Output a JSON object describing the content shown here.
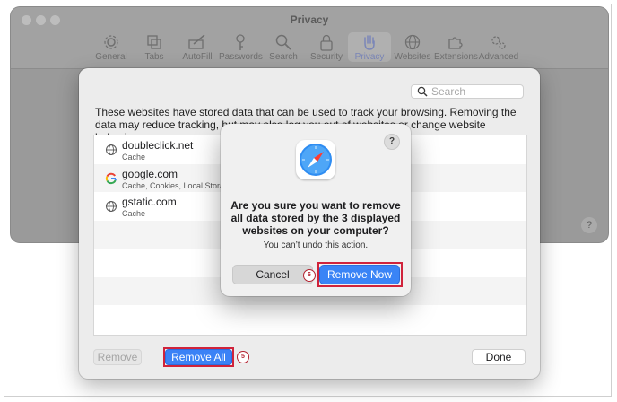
{
  "window": {
    "title": "Privacy",
    "tabs": [
      {
        "label": "General",
        "icon": "gear-icon"
      },
      {
        "label": "Tabs",
        "icon": "tabs-icon"
      },
      {
        "label": "AutoFill",
        "icon": "autofill-icon"
      },
      {
        "label": "Passwords",
        "icon": "key-icon"
      },
      {
        "label": "Search",
        "icon": "search-icon"
      },
      {
        "label": "Security",
        "icon": "lock-icon"
      },
      {
        "label": "Privacy",
        "icon": "hand-icon",
        "active": true
      },
      {
        "label": "Websites",
        "icon": "globe-icon"
      },
      {
        "label": "Extensions",
        "icon": "puzzle-icon"
      },
      {
        "label": "Advanced",
        "icon": "gears-icon"
      }
    ],
    "help_label": "?"
  },
  "sheet": {
    "search_placeholder": "Search",
    "description": "These websites have stored data that can be used to track your browsing. Removing the data may reduce tracking, but may also log you out of websites or change website behavior.",
    "sites": [
      {
        "name": "doubleclick.net",
        "detail": "Cache",
        "icon": "globe-icon"
      },
      {
        "name": "google.com",
        "detail": "Cache, Cookies, Local Storage",
        "icon": "google-icon"
      },
      {
        "name": "gstatic.com",
        "detail": "Cache",
        "icon": "globe-icon"
      }
    ],
    "remove_label": "Remove",
    "remove_all_label": "Remove All",
    "done_label": "Done",
    "step_badge": "5"
  },
  "alert": {
    "title": "Are you sure you want to remove all data stored by the 3 displayed websites on your computer?",
    "message": "You can’t undo this action.",
    "cancel_label": "Cancel",
    "remove_now_label": "Remove Now",
    "help_label": "?",
    "step_badge": "6"
  },
  "colors": {
    "accent": "#3a84f6",
    "highlight": "#d0233b"
  }
}
